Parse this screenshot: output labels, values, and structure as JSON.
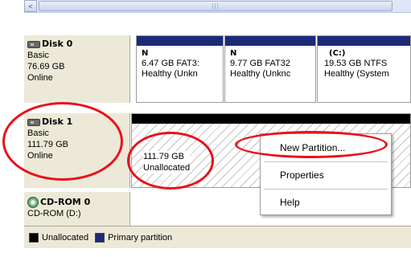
{
  "scrollbar": {
    "left_arrow": "<",
    "thumb_grip": "|||"
  },
  "disk0": {
    "name": "Disk 0",
    "type": "Basic",
    "size": "76.69 GB",
    "status": "Online",
    "partitions": [
      {
        "name": "N",
        "info": "6.47 GB FAT3:",
        "status": "Healthy (Unkn"
      },
      {
        "name": "N",
        "info": "9.77 GB FAT32",
        "status": "Healthy (Unknc"
      },
      {
        "name": "(C:)",
        "info": "19.53 GB NTFS",
        "status": "Healthy (System"
      }
    ]
  },
  "disk1": {
    "name": "Disk 1",
    "type": "Basic",
    "size": "111.79 GB",
    "status": "Online",
    "unallocated": {
      "size": "111.79 GB",
      "label": "Unallocated"
    }
  },
  "cdrom": {
    "name": "CD-ROM 0",
    "drive": "CD-ROM (D:)"
  },
  "legend": {
    "unallocated": "Unallocated",
    "primary": "Primary partition"
  },
  "context_menu": {
    "new_partition": "New Partition...",
    "properties": "Properties",
    "help": "Help"
  },
  "colors": {
    "primary_partition": "#1c2a78",
    "unallocated": "#000000",
    "annotation": "#e8121b"
  }
}
